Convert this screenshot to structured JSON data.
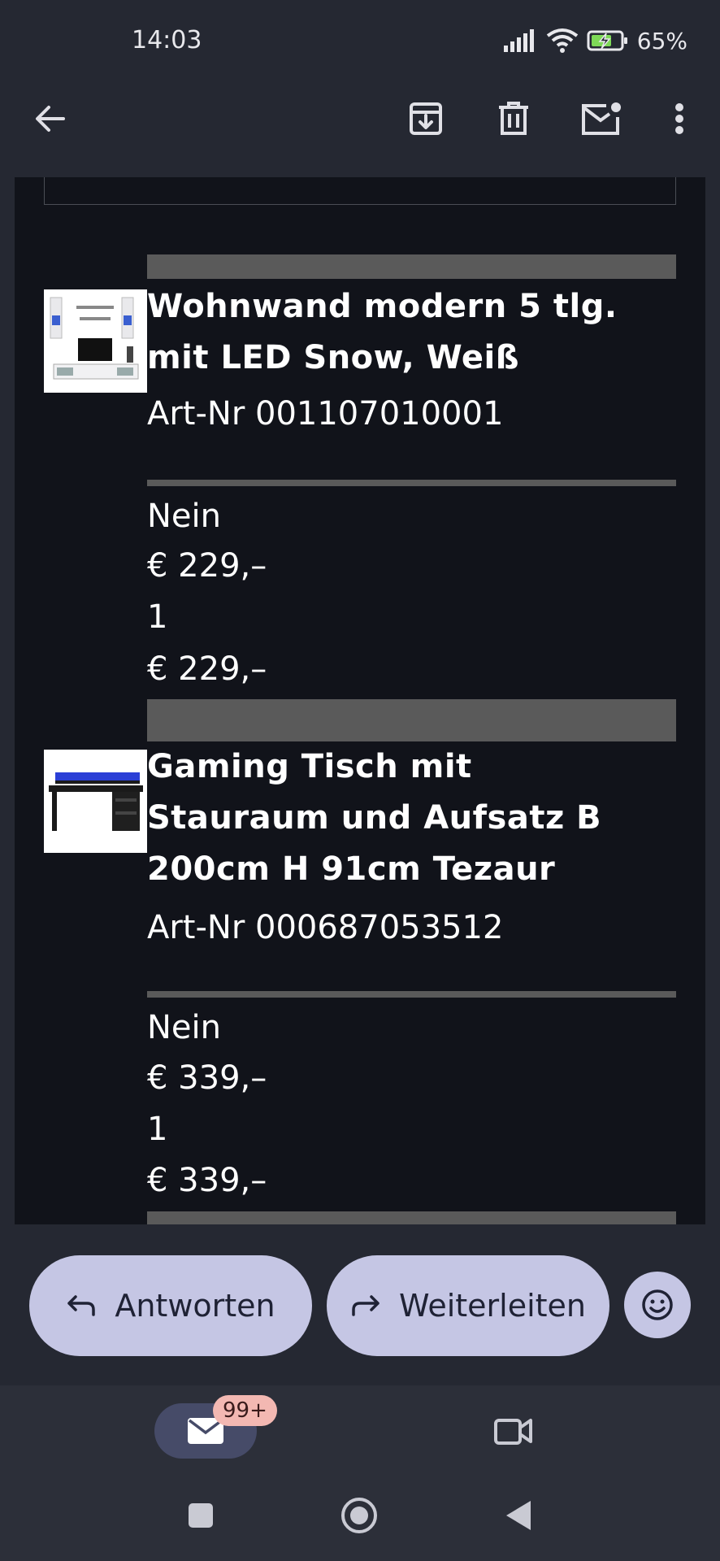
{
  "status_bar": {
    "time": "14:03",
    "battery": "65%"
  },
  "app_bar": {
    "back_icon": "arrow-back-icon",
    "archive_icon": "archive-icon",
    "delete_icon": "trash-icon",
    "mark_unread_icon": "mail-unread-icon",
    "more_icon": "more-vert-icon"
  },
  "products": [
    {
      "title_line1": "Wohnwand modern 5 tlg.",
      "title_line2": "mit LED Snow, Weiß",
      "art_nr": "Art-Nr 001107010001",
      "option": "Nein",
      "price": "€ 229,–",
      "quantity": "1",
      "total": "€ 229,–"
    },
    {
      "title_line1": "Gaming Tisch mit",
      "title_line2": "Stauraum und Aufsatz B",
      "title_line3": "200cm H 91cm Tezaur",
      "art_nr": "Art-Nr 000687053512",
      "option": "Nein",
      "price": "€ 339,–",
      "quantity": "1",
      "total": "€ 339,–"
    }
  ],
  "actions": {
    "reply_label": "Antworten",
    "forward_label": "Weiterleiten"
  },
  "bottom_nav": {
    "mail_badge": "99+"
  },
  "colors": {
    "background": "#252832",
    "email_body": "#11131a",
    "pill": "#c5c6e4",
    "badge": "#f3b8b2",
    "divider": "#5a5a5a"
  }
}
